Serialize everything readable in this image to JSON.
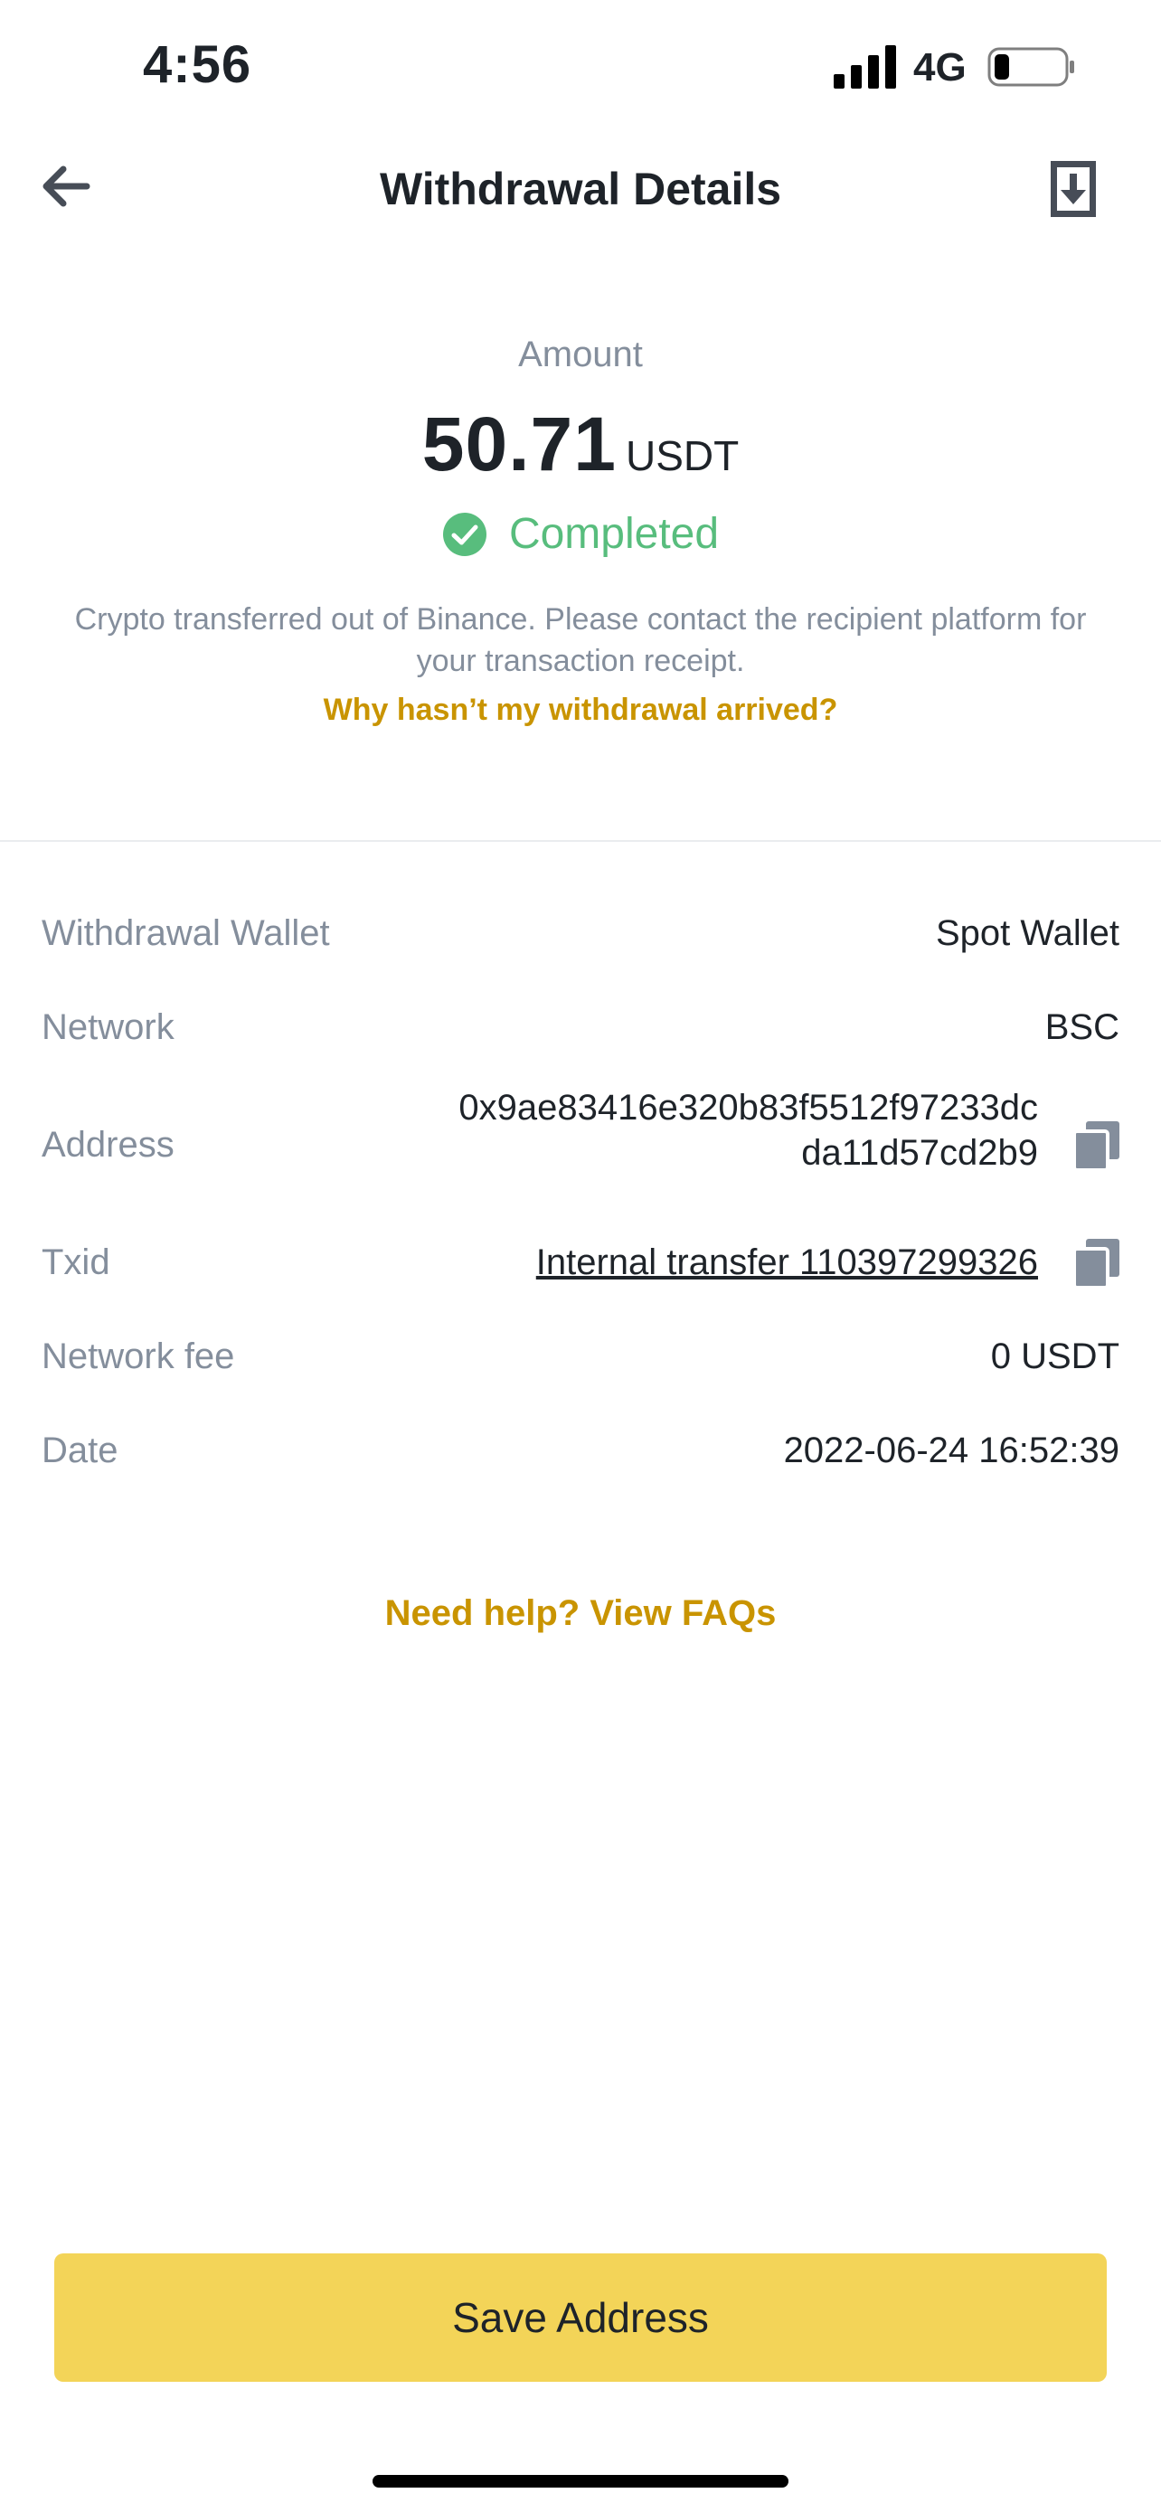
{
  "status_bar": {
    "time": "4:56",
    "network": "4G",
    "battery_level": 0.22
  },
  "header": {
    "title": "Withdrawal Details",
    "back_icon": "arrow-left-icon",
    "export_icon": "download-receipt-icon"
  },
  "summary": {
    "amount_label": "Amount",
    "amount_value": "50.71",
    "amount_unit": "USDT",
    "status": "Completed",
    "status_color": "#58bd7d",
    "notice": "Crypto transferred out of Binance. Please contact the recipient platform for your transaction receipt.",
    "help_link": "Why hasn’t my withdrawal arrived?"
  },
  "details": {
    "withdrawal_wallet": {
      "label": "Withdrawal Wallet",
      "value": "Spot Wallet"
    },
    "network": {
      "label": "Network",
      "value": "BSC"
    },
    "address": {
      "label": "Address",
      "value_line1": "0x9ae83416e320b83f5512f97233dc",
      "value_line2": "da11d57cd2b9"
    },
    "txid": {
      "label": "Txid",
      "value": "Internal transfer 110397299326"
    },
    "network_fee": {
      "label": "Network fee",
      "value": "0 USDT"
    },
    "date": {
      "label": "Date",
      "value": "2022-06-24 16:52:39"
    }
  },
  "faq_link": "Need help? View FAQs",
  "primary_button": "Save Address",
  "colors": {
    "accent": "#c99400",
    "button": "#f3d458",
    "muted_text": "#848e9c"
  }
}
